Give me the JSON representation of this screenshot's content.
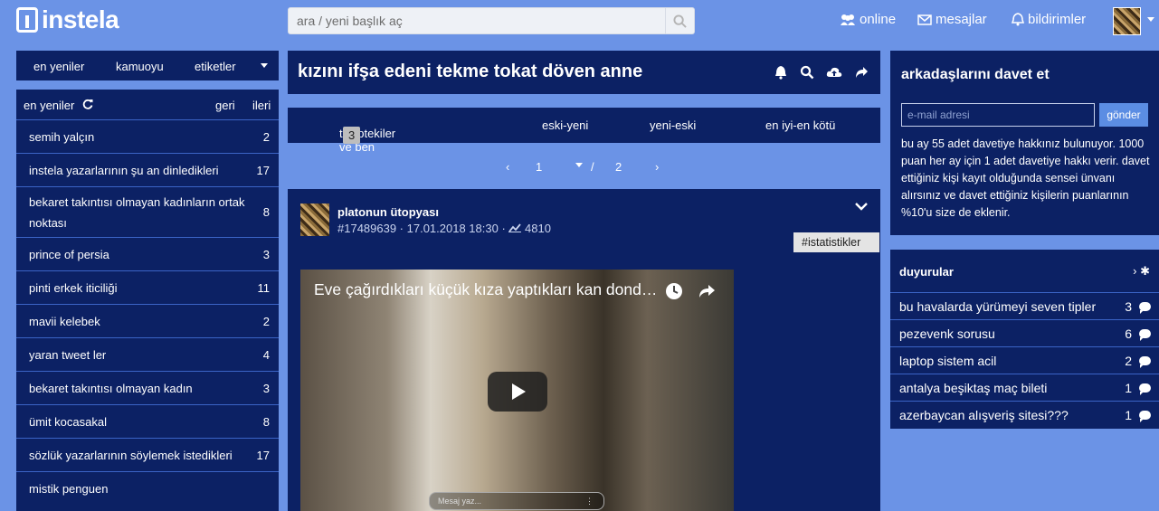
{
  "header": {
    "logo_text": "instela",
    "search_placeholder": "ara / yeni başlık aç",
    "nav": [
      {
        "label": "online",
        "icon": "users-icon"
      },
      {
        "label": "mesajlar",
        "icon": "envelope-icon"
      },
      {
        "label": "bildirimler",
        "icon": "bell-icon"
      }
    ]
  },
  "left": {
    "tabs": [
      "en yeniler",
      "kamuoyu",
      "etiketler"
    ],
    "head": {
      "title": "en yeniler",
      "prev": "geri",
      "next": "ileri"
    },
    "items": [
      {
        "label": "semih yalçın",
        "count": "2"
      },
      {
        "label": "instela yazarlarının şu an dinledikleri",
        "count": "17"
      },
      {
        "label": "bekaret takıntısı olmayan kadınların ortak noktası",
        "count": "8"
      },
      {
        "label": "prince of persia",
        "count": "3"
      },
      {
        "label": "pinti erkek iticiliği",
        "count": "11"
      },
      {
        "label": "mavii kelebek",
        "count": "2"
      },
      {
        "label": "yaran tweet ler",
        "count": "4"
      },
      {
        "label": "bekaret takıntısı olmayan kadın",
        "count": "3"
      },
      {
        "label": "ümit kocasakal",
        "count": "8"
      },
      {
        "label": "sözlük yazarlarının söylemek istedikleri",
        "count": "17"
      },
      {
        "label": "mistik penguen",
        "count": ""
      }
    ]
  },
  "topic": {
    "title": "kızını ifşa edeni tekme tokat döven anne",
    "sort": {
      "follow_label": "takiptekiler ve ben",
      "follow_count": "3",
      "old_new": "eski-yeni",
      "new_old": "yeni-eski",
      "best_worst": "en iyi-en kötü"
    },
    "pager": {
      "current": "1",
      "separator": "/",
      "total": "2"
    }
  },
  "entry": {
    "author": "platonun ütopyası",
    "meta": "#17489639 · 17.01.2018 18:30 ·",
    "views": "4810",
    "tag": "#istatistikler",
    "video_title": "Eve çağırdıkları küçük kıza yaptıkları kan dondurucu",
    "video_msg_placeholder": "Mesaj yaz..."
  },
  "invite": {
    "title": "arkadaşlarını davet et",
    "email_placeholder": "e-mail adresi",
    "send_label": "gönder",
    "text": "bu ay 55 adet davetiye hakkınız bulunuyor. 1000 puan her ay için 1 adet davetiye hakkı verir. davet ettiğiniz kişi kayıt olduğunda sensei ünvanı alırsınız ve davet ettiğiniz kişilerin puanlarının %10'u size de eklenir."
  },
  "announcements": {
    "title": "duyurular",
    "items": [
      {
        "label": "bu havalarda yürümeyi seven tipler",
        "count": "3"
      },
      {
        "label": "pezevenk sorusu",
        "count": "6"
      },
      {
        "label": "laptop sistem acil",
        "count": "2"
      },
      {
        "label": "antalya beşiktaş maç bileti",
        "count": "1"
      },
      {
        "label": "azerbaycan alışveriş sitesi???",
        "count": "1"
      }
    ]
  }
}
